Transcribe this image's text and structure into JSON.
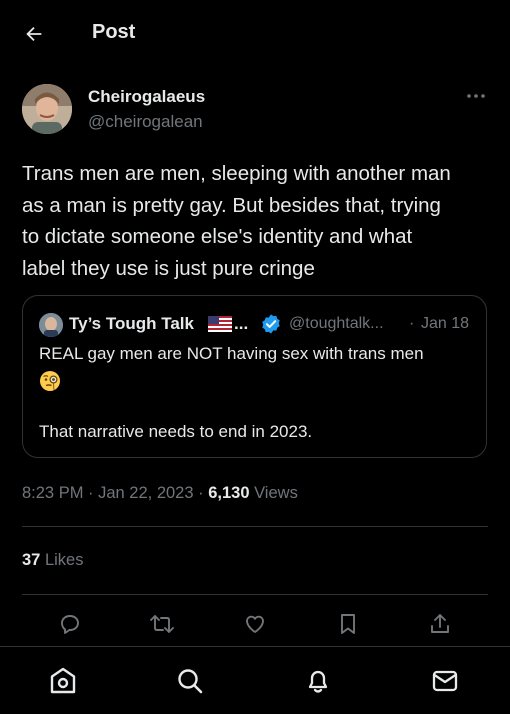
{
  "header": {
    "title": "Post",
    "back_icon": "arrow-left-icon"
  },
  "post": {
    "author_name": "Cheirogalaeus",
    "author_handle": "@cheirogalean",
    "text": "Trans men are men, sleeping with another man\nas a man is pretty gay. But besides that, trying\nto dictate someone else's identity and what\nlabel they use is just pure cringe",
    "time": "8:23 PM",
    "dot1": " · ",
    "date": "Jan 22, 2023",
    "dot2": " · ",
    "views_count": "6,130",
    "views_label": " Views",
    "likes_count": "37",
    "likes_label": " Likes"
  },
  "quote": {
    "name": "Ty’s Tough Talk",
    "ellipsis": "...",
    "handle": "@toughtalk...",
    "separator": "·",
    "date": "Jan 18",
    "line1": "REAL gay men are NOT having sex with trans men",
    "line2": "That narrative needs to end in 2023.",
    "emoji": "face-with-monocle-emoji",
    "flag": "us-flag-emoji"
  },
  "actions": [
    "reply-icon",
    "retweet-icon",
    "like-icon",
    "bookmark-icon",
    "share-icon"
  ],
  "bottom_nav": [
    "home-icon",
    "search-icon",
    "notifications-icon",
    "messages-icon"
  ],
  "colors": {
    "background": "#000000",
    "text": "#e7e9ea",
    "secondary": "#71767b",
    "border": "#2f3336",
    "verified": "#1d9bf0"
  }
}
